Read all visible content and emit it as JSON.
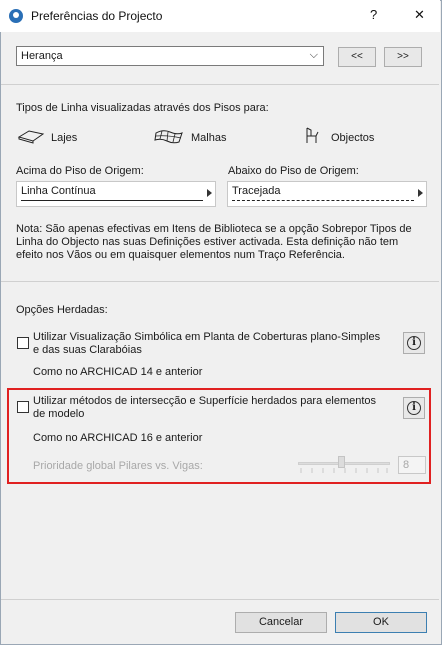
{
  "window": {
    "title": "Preferências do Projecto",
    "help": "?",
    "close": "✕"
  },
  "top": {
    "selected": "Herança",
    "prev": "<<",
    "next": ">>"
  },
  "line_types": {
    "heading": "Tipos de Linha visualizadas através dos Pisos para:",
    "lajes": "Lajes",
    "malhas": "Malhas",
    "objectos": "Objectos"
  },
  "above": {
    "label": "Acima do Piso de Origem:",
    "value": "Linha Contínua"
  },
  "below": {
    "label": "Abaixo do Piso de Origem:",
    "value": "Tracejada"
  },
  "note": {
    "line1": "Nota: São apenas efectivas em Itens de Biblioteca se a opção Sobrepor Tipos de",
    "line2": "Linha do Objecto nas suas Definições estiver activada. Esta definição não tem",
    "line3": "efeito nos Vãos ou em quaisquer elementos num Traço Referência."
  },
  "inherited": {
    "heading": "Opções Herdadas:",
    "opt1": {
      "line1": "Utilizar Visualização Simbólica em Planta de Coberturas plano-Simples",
      "line2": "e das suas Clarabóias",
      "sub": "Como no ARCHICAD 14 e anterior"
    },
    "opt2": {
      "line1": "Utilizar métodos de intersecção e Superfície herdados para elementos",
      "line2": "de modelo",
      "sub": "Como no ARCHICAD 16 e anterior",
      "priority_label": "Prioridade global Pilares vs. Vigas:",
      "priority_value": "8"
    }
  },
  "buttons": {
    "cancel": "Cancelar",
    "ok": "OK"
  }
}
